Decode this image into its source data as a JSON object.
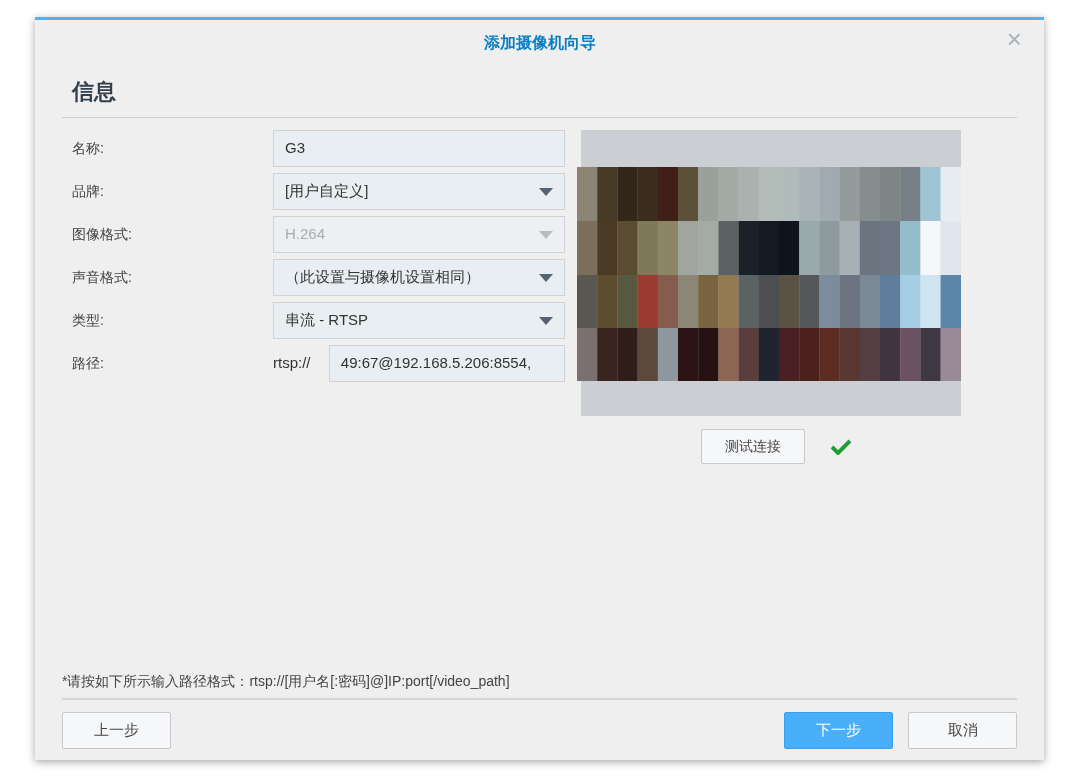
{
  "window": {
    "title": "添加摄像机向导",
    "close": "×"
  },
  "section_title": "信息",
  "fields": [
    {
      "label": "名称:",
      "kind": "text",
      "value": "G3",
      "disabled": false
    },
    {
      "label": "品牌:",
      "kind": "select",
      "value": "[用户自定义]",
      "disabled": false
    },
    {
      "label": "图像格式:",
      "kind": "select",
      "value": "H.264",
      "disabled": true
    },
    {
      "label": "声音格式:",
      "kind": "select",
      "value": "（此设置与摄像机设置相同）",
      "disabled": false
    },
    {
      "label": "类型:",
      "kind": "select",
      "value": "串流 - RTSP",
      "disabled": false
    },
    {
      "label": "路径:",
      "kind": "path",
      "prefix": "rtsp://",
      "value": "49:67@192.168.5.206:8554,",
      "disabled": false
    }
  ],
  "test_button": "测试连接",
  "test_ok": true,
  "hint": "*请按如下所示输入路径格式：rtsp://[用户名[:密码]@]IP:port[/video_path]",
  "buttons": [
    {
      "label": "上一步",
      "primary": false
    },
    {
      "label": "下一步",
      "primary": true
    },
    {
      "label": "取消",
      "primary": false
    }
  ]
}
